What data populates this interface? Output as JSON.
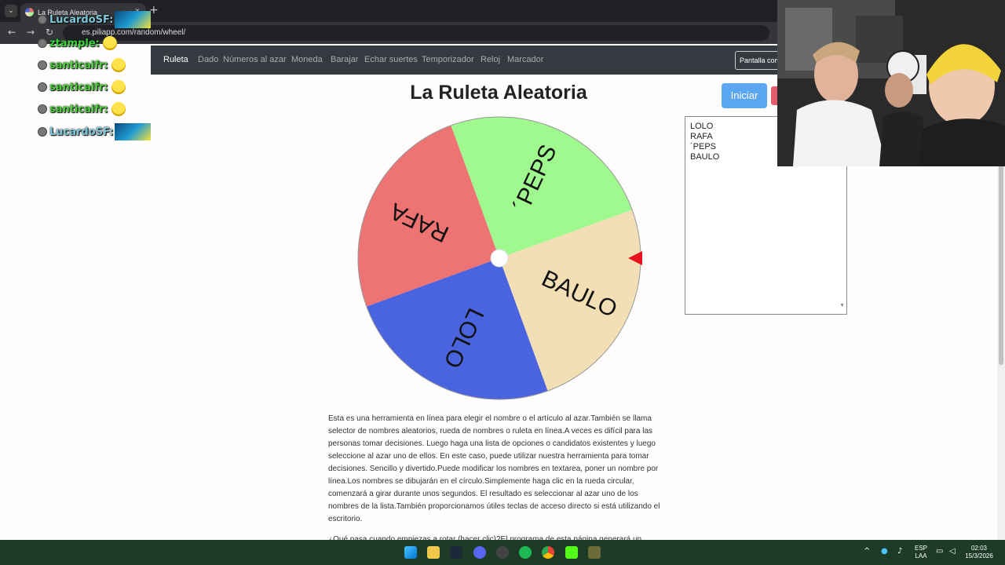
{
  "browser": {
    "tab_title": "La Ruleta Aleatoria",
    "url": "es.piliapp.com/random/wheel/",
    "tabs_menu_glyph": "⌄",
    "new_tab_glyph": "+",
    "close_glyph": "×",
    "back_glyph": "←",
    "forward_glyph": "→",
    "reload_glyph": "↻"
  },
  "nav": {
    "items": [
      "Ruleta",
      "Dado",
      "Números al azar",
      "Moneda",
      "Barajar",
      "Echar suertes",
      "Temporizador",
      "Reloj",
      "Marcador"
    ],
    "active_index": 0,
    "fullscreen_label": "Pantalla com"
  },
  "chat": [
    {
      "user": "LucardoSF:",
      "color": "#7ec8d8"
    },
    {
      "user": "ztample:",
      "color": "#3cd23c"
    },
    {
      "user": "santicaifr:",
      "color": "#4ccf3a"
    },
    {
      "user": "santicaifr:",
      "color": "#4ccf3a"
    },
    {
      "user": "santicaifr:",
      "color": "#4ccf3a"
    },
    {
      "user": "LucardoSF:",
      "color": "#7ec8d8"
    }
  ],
  "page": {
    "title": "La Ruleta Aleatoria",
    "start_label": "Iniciar",
    "names_text": [
      "LOLO",
      "RAFA",
      "´PEPS",
      "BAULO"
    ],
    "description": "Esta es una herramienta en línea para elegir el nombre o el artículo al azar.También se llama selector de nombres aleatorios, rueda de nombres o ruleta en línea.A veces es difícil para las personas tomar decisiones. Luego haga una lista de opciones o candidatos existentes y luego seleccione al azar uno de ellos. En este caso, puede utilizar nuestra herramienta para tomar decisiones. Sencillo y divertido.Puede modificar los nombres en textarea, poner un nombre por línea.Los nombres se dibujarán en el círculo.Simplemente haga clic en la rueda circular, comenzará a girar durante unos segundos. El resultado es seleccionar al azar uno de los nombres de la lista.También proporcionamos útiles teclas de acceso directo si está utilizando el escritorio.",
    "description_cut": "¿Qué pasa cuando empiezas a rotar (hacer clic)?El programa de esta página generará un"
  },
  "wheel": {
    "segments": [
      {
        "label": "RAFA",
        "color": "#ee7474"
      },
      {
        "label": "´PEPS",
        "color": "#9ff98f"
      },
      {
        "label": "BAULO",
        "color": "#f2dfb6"
      },
      {
        "label": "LOLO",
        "color": "#4a63de"
      }
    ],
    "pointer_color": "#e8141b"
  },
  "taskbar": {
    "lang_top": "ESP",
    "lang_bottom": "LAA",
    "time": "02:03",
    "date": "15/3/2026"
  }
}
